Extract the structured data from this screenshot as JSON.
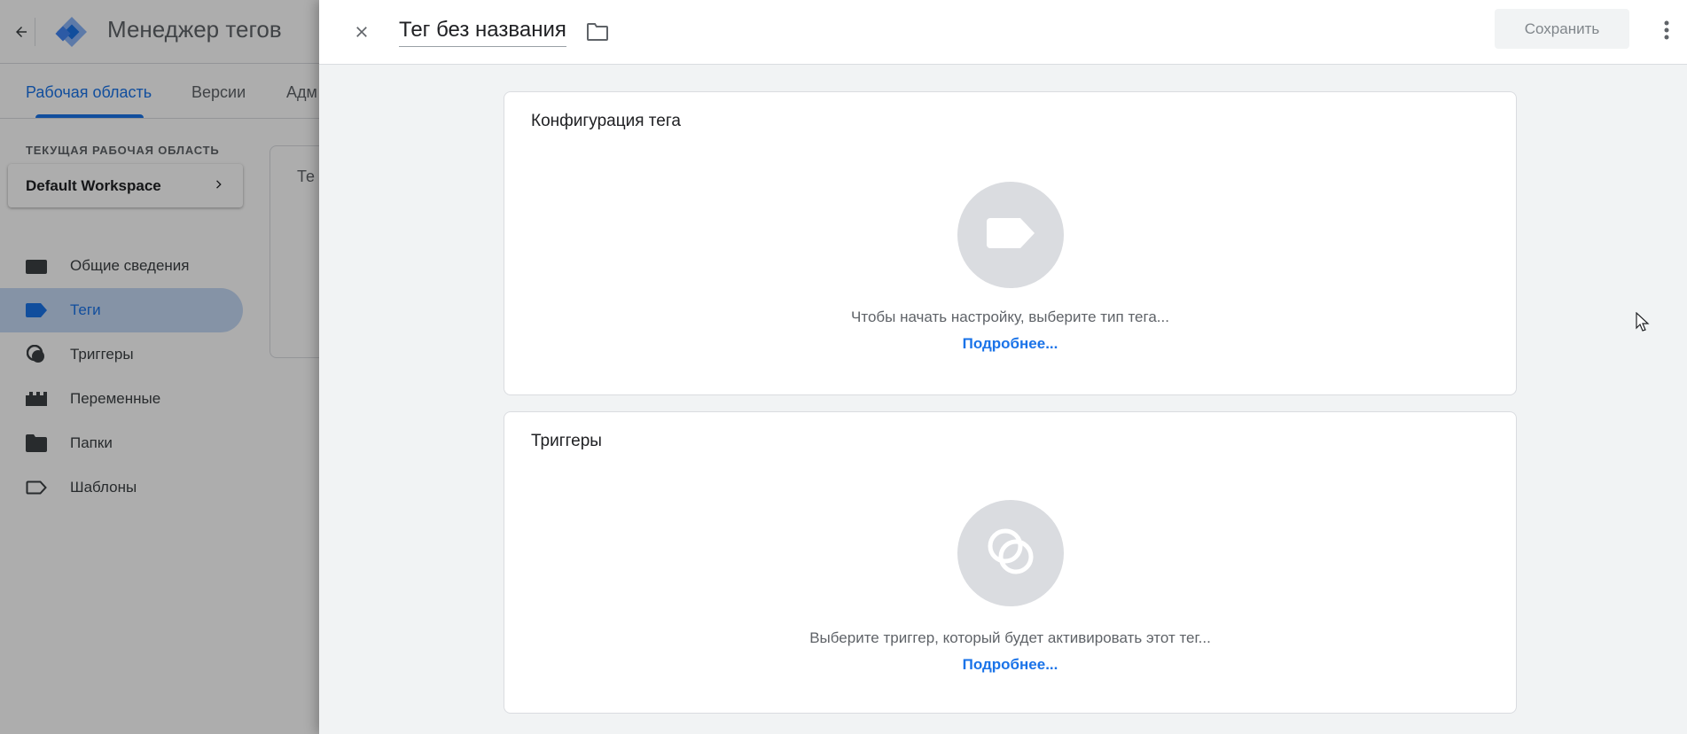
{
  "app": {
    "title": "Менеджер тегов"
  },
  "tabs": [
    {
      "label": "Рабочая область",
      "active": true
    },
    {
      "label": "Версии",
      "active": false
    },
    {
      "label": "Адм",
      "active": false
    }
  ],
  "workspace": {
    "section_label": "ТЕКУЩАЯ РАБОЧАЯ ОБЛАСТЬ",
    "name": "Default Workspace"
  },
  "sidebar": {
    "items": [
      {
        "label": "Общие сведения",
        "icon": "briefcase-icon",
        "active": false
      },
      {
        "label": "Теги",
        "icon": "tag-icon",
        "active": true
      },
      {
        "label": "Триггеры",
        "icon": "trigger-icon",
        "active": false
      },
      {
        "label": "Переменные",
        "icon": "variables-icon",
        "active": false
      },
      {
        "label": "Папки",
        "icon": "folder-icon",
        "active": false
      },
      {
        "label": "Шаблоны",
        "icon": "template-icon",
        "active": false
      }
    ]
  },
  "content_card": {
    "title": "Те"
  },
  "panel": {
    "tag_name": "Тег без названия",
    "save_label": "Сохранить",
    "config_card": {
      "title": "Конфигурация тега",
      "hint": "Чтобы начать настройку, выберите тип тега...",
      "link": "Подробнее..."
    },
    "triggers_card": {
      "title": "Триггеры",
      "hint": "Выберите триггер, который будет активировать этот тег...",
      "link": "Подробнее..."
    }
  },
  "colors": {
    "accent": "#1a73e8",
    "placeholder_circle": "#dadce0",
    "panel_bg": "#f1f3f4"
  }
}
